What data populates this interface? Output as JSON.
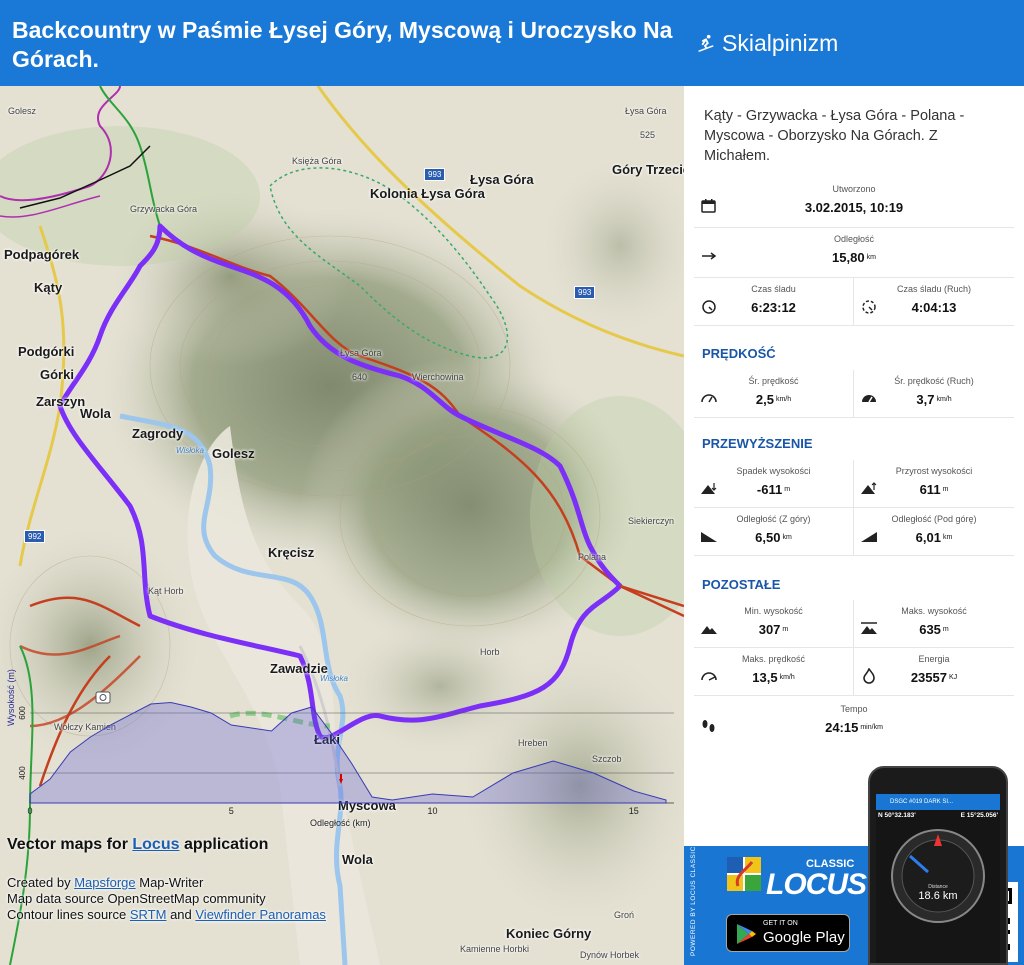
{
  "header": {
    "title": "Backcountry w Paśmie Łysej Góry, Myscową i Uroczysko Na Górach.",
    "activity": "Skialpinizm",
    "activity_icon": "skier-icon"
  },
  "map": {
    "places": [
      {
        "name": "Golesz",
        "size": "small"
      },
      {
        "name": "Podpagórek"
      },
      {
        "name": "Kąty"
      },
      {
        "name": "Podgórki"
      },
      {
        "name": "Górki"
      },
      {
        "name": "Zarszyn"
      },
      {
        "name": "Wola"
      },
      {
        "name": "Zagrody"
      },
      {
        "name": "Golesz"
      },
      {
        "name": "Kręcisz"
      },
      {
        "name": "Zawadzie"
      },
      {
        "name": "Łaki"
      },
      {
        "name": "Myscowa"
      },
      {
        "name": "Wola"
      },
      {
        "name": "Koniec Górny"
      },
      {
        "name": "Łysa Góra"
      },
      {
        "name": "Kolonia Łysa Góra"
      },
      {
        "name": "Góry Trzecie"
      },
      {
        "name": "Grzywacka Góra",
        "size": "small"
      },
      {
        "name": "Księża Góra",
        "size": "small"
      },
      {
        "name": "Łysa Góra",
        "size": "small"
      },
      {
        "name": "Wierchowina",
        "size": "small"
      },
      {
        "name": "Polana",
        "size": "small"
      },
      {
        "name": "Horb",
        "size": "small"
      },
      {
        "name": "Kąt Horb",
        "size": "small"
      },
      {
        "name": "Hreben",
        "size": "small"
      },
      {
        "name": "Szczob",
        "size": "small"
      },
      {
        "name": "Wołczy Kamień",
        "size": "small"
      },
      {
        "name": "Groń",
        "size": "small"
      },
      {
        "name": "Kamienne Horbki",
        "size": "small"
      },
      {
        "name": "Dynów Horbek",
        "size": "small"
      },
      {
        "name": "Wisłoka",
        "size": "water"
      },
      {
        "name": "Wisłoka",
        "size": "water"
      },
      {
        "name": "Łysa Góra",
        "size": "small"
      },
      {
        "name": "Siekierczyn",
        "size": "small"
      }
    ],
    "road_numbers": [
      "993",
      "993",
      "992"
    ],
    "spot_heights": [
      "525",
      "640"
    ],
    "route_color": "#7b2ff7"
  },
  "elevation_chart": {
    "ylabel": "Wysokość (m)",
    "xlabel": "Odległość (km)",
    "y_ticks": [
      "600",
      "400"
    ],
    "x_ticks": [
      "0",
      "5",
      "10",
      "15"
    ]
  },
  "chart_data": {
    "type": "area",
    "title": "",
    "xlabel": "Odległość (km)",
    "ylabel": "Wysokość (m)",
    "ylim": [
      300,
      650
    ],
    "xlim": [
      0,
      16
    ],
    "x": [
      0,
      0.5,
      1,
      1.5,
      2,
      3,
      3.5,
      4,
      4.5,
      5,
      6,
      6.5,
      7,
      7.5,
      8,
      8.5,
      9,
      10,
      11,
      12,
      13,
      14,
      15,
      15.8
    ],
    "values": [
      330,
      380,
      470,
      520,
      560,
      630,
      635,
      620,
      600,
      560,
      540,
      600,
      620,
      530,
      430,
      320,
      310,
      330,
      320,
      400,
      440,
      400,
      340,
      310
    ]
  },
  "attribution": {
    "vector_maps_prefix": "Vector maps for ",
    "vector_maps_link": "Locus",
    "vector_maps_suffix": " application",
    "line1_prefix": "Created by ",
    "line1_link": "Mapsforge",
    "line1_suffix": " Map-Writer",
    "line2": "Map data source OpenStreetMap community",
    "line3_prefix": "Contour lines source ",
    "line3_link1": "SRTM",
    "line3_mid": " and ",
    "line3_link2": "Viewfinder Panoramas"
  },
  "stats": {
    "description": "Kąty - Grzywacka - Łysa Góra - Polana - Myscowa - Oborzysko Na Górach. Z Michałem.",
    "created_label": "Utworzono",
    "created_value": "3.02.2015, 10:19",
    "distance_label": "Odległość",
    "distance_value": "15,80",
    "distance_unit": "km",
    "track_time_label": "Czas śladu",
    "track_time_value": "6:23:12",
    "track_time_moving_label": "Czas śladu (Ruch)",
    "track_time_moving_value": "4:04:13",
    "speed_section": "PRĘDKOŚĆ",
    "avg_speed_label": "Śr. prędkość",
    "avg_speed_value": "2,5",
    "avg_speed_moving_label": "Śr. prędkość (Ruch)",
    "avg_speed_moving_value": "3,7",
    "speed_unit": "km/h",
    "elevation_section": "PRZEWYŻSZENIE",
    "descent_label": "Spadek wysokości",
    "descent_value": "-611",
    "ascent_label": "Przyrost wysokości",
    "ascent_value": "611",
    "meter_unit": "m",
    "dist_down_label": "Odległość (Z góry)",
    "dist_down_value": "6,50",
    "dist_up_label": "Odległość (Pod górę)",
    "dist_up_value": "6,01",
    "other_section": "POZOSTAŁE",
    "min_alt_label": "Min. wysokość",
    "min_alt_value": "307",
    "max_alt_label": "Maks. wysokość",
    "max_alt_value": "635",
    "max_speed_label": "Maks. prędkość",
    "max_speed_value": "13,5",
    "energy_label": "Energia",
    "energy_value": "23557",
    "energy_unit": "KJ",
    "pace_label": "Tempo",
    "pace_value": "24:15",
    "pace_unit": "min/km"
  },
  "promo": {
    "powered_by": "POWERED BY LOCUS CLASSIC",
    "classic": "CLASSIC",
    "locus": "LOCUS",
    "gplay_small": "GET IT ON",
    "gplay_big": "Google Play",
    "accent": "#1976d2"
  },
  "phone": {
    "bar_title": "DSGC #019 DARK SI...",
    "lat": "N 50°32.183'",
    "lon": "E 15°25.056'",
    "distance_label": "Distance",
    "distance_value": "18.6 km"
  }
}
